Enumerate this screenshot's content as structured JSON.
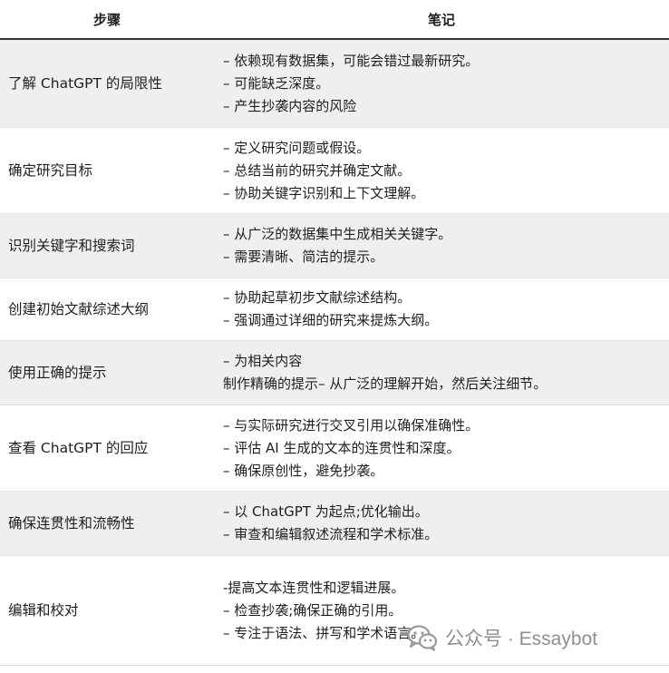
{
  "header": {
    "step": "步骤",
    "notes": "笔记"
  },
  "rows": [
    {
      "step": "了解 ChatGPT 的局限性",
      "notes": [
        "– 依赖现有数据集，可能会错过最新研究。",
        "– 可能缺乏深度。",
        "– 产生抄袭内容的风险"
      ]
    },
    {
      "step": "确定研究目标",
      "notes": [
        "– 定义研究问题或假设。",
        "– 总结当前的研究并确定文献。",
        "– 协助关键字识别和上下文理解。"
      ]
    },
    {
      "step": "识别关键字和搜索词",
      "notes": [
        "– 从广泛的数据集中生成相关关键字。",
        "– 需要清晰、简洁的提示。"
      ]
    },
    {
      "step": "创建初始文献综述大纲",
      "notes": [
        "– 协助起草初步文献综述结构。",
        "– 强调通过详细的研究来提炼大纲。"
      ]
    },
    {
      "step": "使用正确的提示",
      "notes": [
        "– 为相关内容",
        "制作精确的提示– 从广泛的理解开始，然后关注细节。"
      ]
    },
    {
      "step": "查看 ChatGPT 的回应",
      "notes": [
        "– 与实际研究进行交叉引用以确保准确性。",
        "– 评估 AI 生成的文本的连贯性和深度。",
        "– 确保原创性，避免抄袭。"
      ]
    },
    {
      "step": "确保连贯性和流畅性",
      "notes": [
        "– 以 ChatGPT 为起点;优化输出。",
        "– 审查和编辑叙述流程和学术标准。"
      ]
    },
    {
      "step": "编辑和校对",
      "notes": [
        "-提高文本连贯性和逻辑进展。",
        "– 检查抄袭;确保正确的引用。",
        "– 专注于语法、拼写和学术语言。"
      ]
    }
  ],
  "watermark": {
    "text": "公众号 · Essaybot",
    "icon": "wechat-icon"
  }
}
